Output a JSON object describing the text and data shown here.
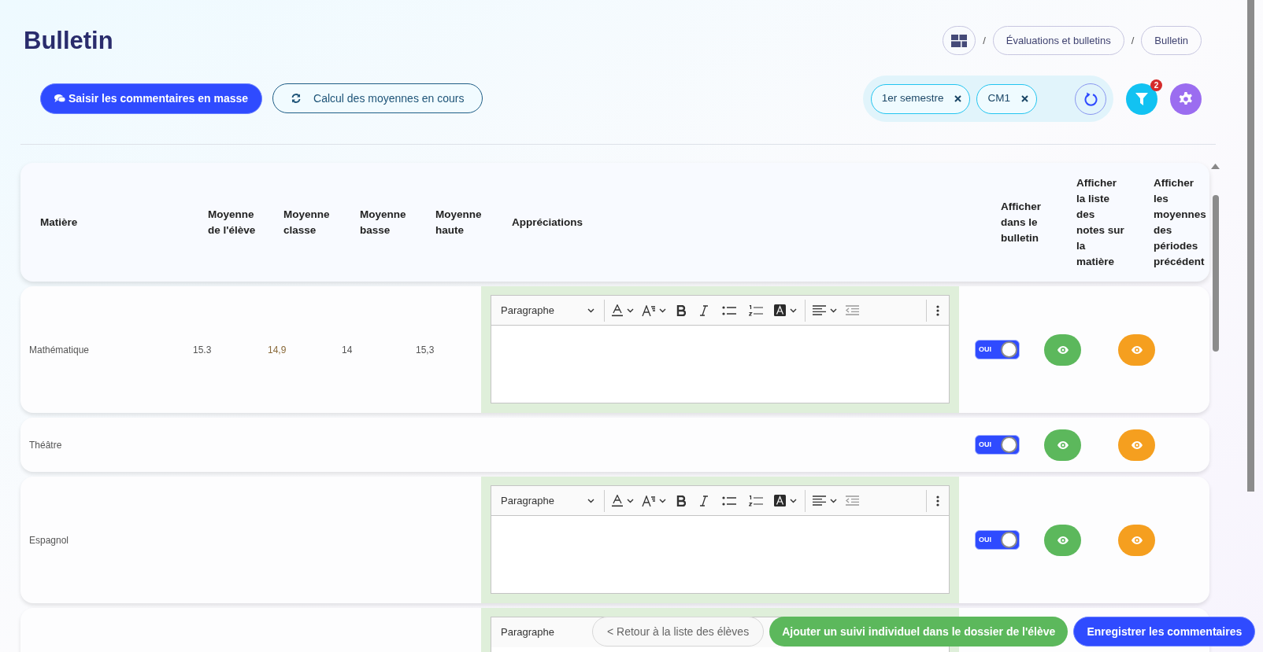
{
  "title": "Bulletin",
  "breadcrumb": [
    {
      "separator": "/",
      "label": "Évaluations et bulletins"
    },
    {
      "separator": "/",
      "label": "Bulletin"
    }
  ],
  "actions": [
    {
      "label": "Saisir les commentaires en masse",
      "kind": "primary"
    },
    {
      "label": "Calcul des moyennes en cours",
      "kind": "outline"
    }
  ],
  "filters": [
    {
      "label": "1er semestre"
    },
    {
      "label": "CM1"
    }
  ],
  "filter_badge": "2",
  "table": {
    "columns": [
      "Matière",
      "Moyenne de l'élève",
      "Moyenne classe",
      "Moyenne basse",
      "Moyenne haute",
      "Appréciations",
      "Afficher dans le bulletin",
      "Afficher la liste des notes sur la matière",
      "Afficher les moyennes des périodes précédent"
    ],
    "rows": [
      {
        "subject": "Mathématique",
        "student": "15.3",
        "class_avg": "14,9",
        "low": "14",
        "high": "15,3",
        "kind": "editor",
        "format": "Paragraphe",
        "toggle": {
          "label": "OUI",
          "on": true
        }
      },
      {
        "subject": "Théâtre",
        "kind": "plain",
        "toggle": {
          "label": "OUI",
          "on": true
        }
      },
      {
        "subject": "Espagnol",
        "kind": "editor",
        "format": "Paragraphe",
        "toggle": {
          "label": "OUI",
          "on": true
        }
      },
      {
        "kind": "editor",
        "format": "Paragraphe"
      }
    ]
  },
  "footer_buttons": [
    {
      "label": "< Retour à la liste des élèves",
      "kind": "secondary"
    },
    {
      "label": "Ajouter un suivi individuel dans le dossier de l'élève",
      "kind": "success"
    },
    {
      "label": "Enregistrer les commentaires",
      "kind": "primary"
    }
  ]
}
